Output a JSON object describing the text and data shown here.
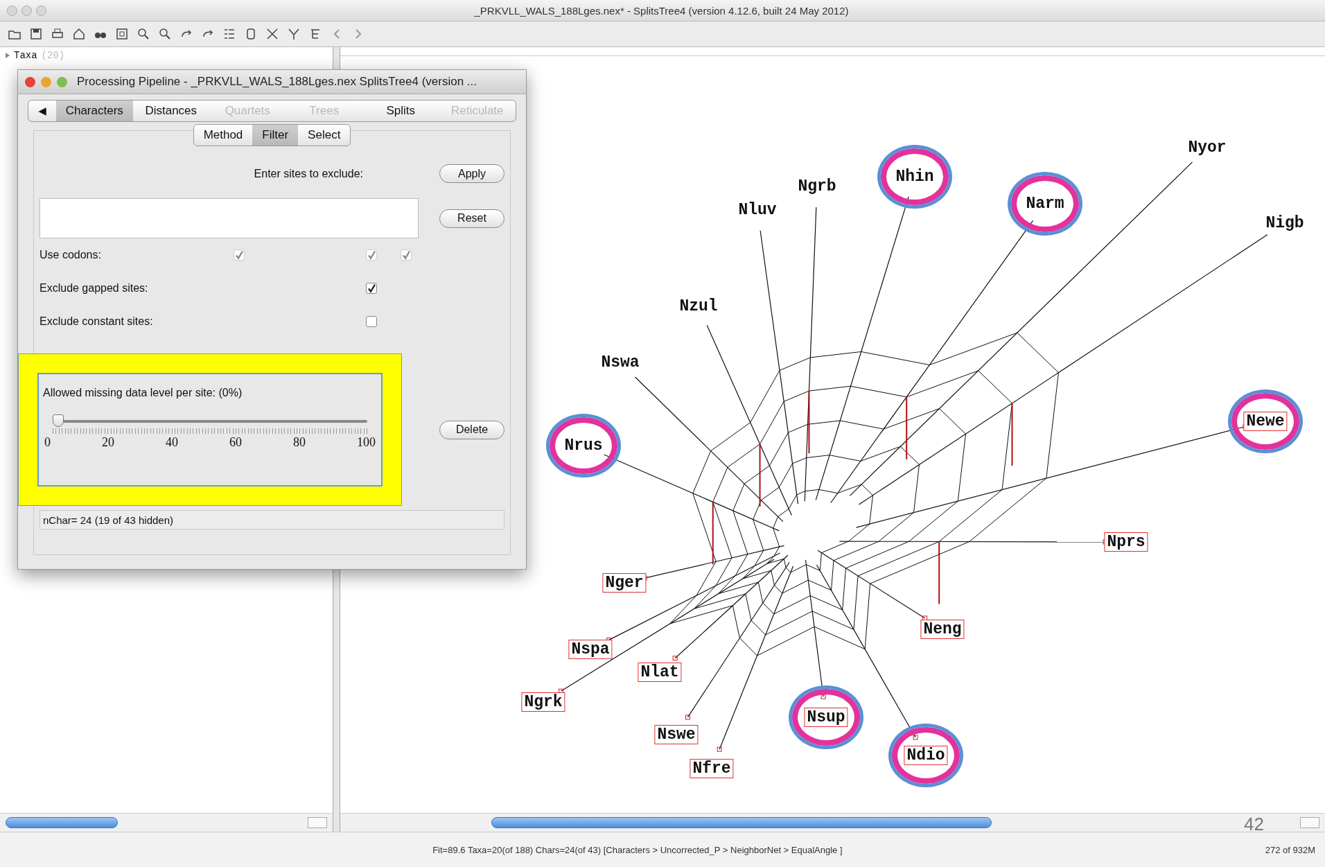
{
  "window": {
    "title": "_PRKVLL_WALS_188Lges.nex* - SplitsTree4 (version 4.12.6, built 24 May 2012)"
  },
  "sidebar": {
    "items": [
      {
        "label": "Taxa",
        "count": "(20)",
        "expanded": false
      }
    ]
  },
  "dialog": {
    "title": "Processing Pipeline - _PRKVLL_WALS_188Lges.nex SplitsTree4 (version ...",
    "back": "◀",
    "tabs": [
      {
        "label": "Characters",
        "selected": true,
        "disabled": false
      },
      {
        "label": "Distances",
        "selected": false,
        "disabled": false
      },
      {
        "label": "Quartets",
        "selected": false,
        "disabled": true
      },
      {
        "label": "Trees",
        "selected": false,
        "disabled": true
      },
      {
        "label": "Splits",
        "selected": false,
        "disabled": false
      },
      {
        "label": "Reticulate",
        "selected": false,
        "disabled": true
      }
    ],
    "subtabs": [
      {
        "label": "Method",
        "selected": false
      },
      {
        "label": "Filter",
        "selected": true
      },
      {
        "label": "Select",
        "selected": false
      }
    ],
    "exclude_label": "Enter sites to exclude:",
    "apply_button": "Apply",
    "reset_button": "Reset",
    "delete_button": "Delete",
    "options": [
      {
        "label": "Use codons:",
        "checkboxes": [
          {
            "checked": true,
            "disabled": true
          },
          {
            "checked": true,
            "disabled": true
          },
          {
            "checked": true,
            "disabled": true
          }
        ]
      },
      {
        "label": "Exclude gapped sites:",
        "checkboxes": [
          {
            "checked": true,
            "disabled": false
          }
        ]
      },
      {
        "label": "Exclude constant sites:",
        "checkboxes": [
          {
            "checked": false,
            "disabled": false
          }
        ]
      }
    ],
    "missing_data": {
      "label": "Allowed missing data level per site: (0%)",
      "level": 0,
      "tick_labels": [
        "0",
        "20",
        "40",
        "60",
        "80",
        "100"
      ]
    },
    "status": "nChar= 24 (19 of 43 hidden)"
  },
  "network": {
    "taxa": [
      {
        "label": "Nyor",
        "boxed": false,
        "circled": false
      },
      {
        "label": "Nigb",
        "boxed": false,
        "circled": false
      },
      {
        "label": "Nhin",
        "boxed": false,
        "circled": true
      },
      {
        "label": "Narm",
        "boxed": false,
        "circled": true
      },
      {
        "label": "Ngrb",
        "boxed": false,
        "circled": false
      },
      {
        "label": "Nluv",
        "boxed": false,
        "circled": false
      },
      {
        "label": "Nzul",
        "boxed": false,
        "circled": false
      },
      {
        "label": "Nswa",
        "boxed": false,
        "circled": false
      },
      {
        "label": "Nrus",
        "boxed": false,
        "circled": true
      },
      {
        "label": "Newe",
        "boxed": true,
        "circled": true
      },
      {
        "label": "Nprs",
        "boxed": true,
        "circled": false
      },
      {
        "label": "Neng",
        "boxed": true,
        "circled": false
      },
      {
        "label": "Nsup",
        "boxed": true,
        "circled": true
      },
      {
        "label": "Ndio",
        "boxed": true,
        "circled": true
      },
      {
        "label": "Nfre",
        "boxed": true,
        "circled": false
      },
      {
        "label": "Nswe",
        "boxed": true,
        "circled": false
      },
      {
        "label": "Ngrk",
        "boxed": true,
        "circled": false
      },
      {
        "label": "Nlat",
        "boxed": true,
        "circled": false
      },
      {
        "label": "Nspa",
        "boxed": true,
        "circled": false
      },
      {
        "label": "Nger",
        "boxed": true,
        "circled": false
      }
    ]
  },
  "slide_number": "42",
  "status_bar": {
    "text": "Fit=89.6 Taxa=20(of 188) Chars=24(of 43) [Characters > Uncorrected_P > NeighborNet > EqualAngle ]",
    "memory": "272 of 932M"
  }
}
